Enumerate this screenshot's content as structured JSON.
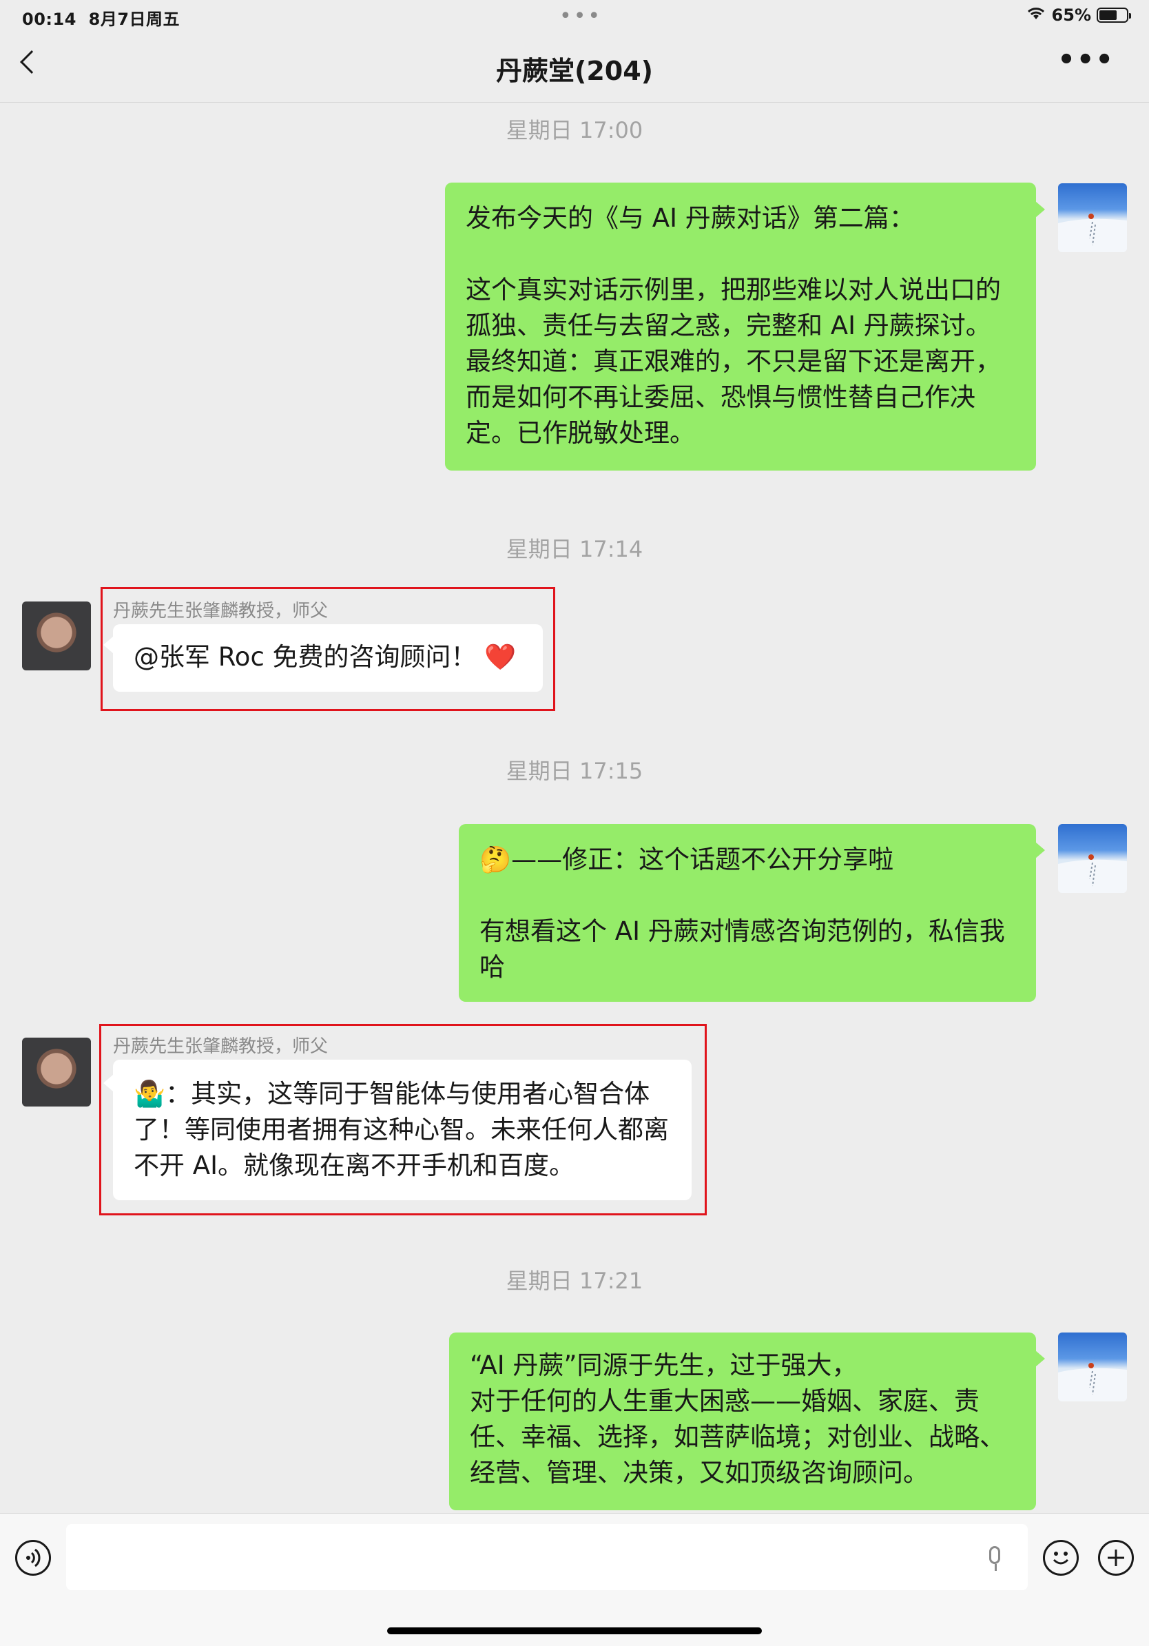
{
  "status_bar": {
    "time": "00:14",
    "date": "8月7日周五",
    "battery": "65%",
    "battery_level": 0.65
  },
  "header": {
    "title": "丹蕨堂(204)"
  },
  "timestamps": [
    "星期日 17:00",
    "星期日 17:14",
    "星期日 17:15",
    "星期日 17:21"
  ],
  "messages": [
    {
      "side": "right",
      "text": "发布今天的《与 AI 丹蕨对话》第二篇：\n\n这个真实对话示例里，把那些难以对人说出口的孤独、责任与去留之惑，完整和 AI 丹蕨探讨。最终知道：真正艰难的，不只是留下还是离开，而是如何不再让委屈、恐惧与惯性替自己作决定。已作脱敏处理。"
    },
    {
      "side": "left",
      "sender": "丹蕨先生张肇麟教授，师父",
      "text": "@张军 Roc 免费的咨询顾问！ ❤️"
    },
    {
      "side": "right",
      "text": "🤔——修正：这个话题不公开分享啦\n\n有想看这个 AI 丹蕨对情感咨询范例的，私信我哈"
    },
    {
      "side": "left",
      "sender": "丹蕨先生张肇麟教授，师父",
      "text": "🤷‍♂️：其实，这等同于智能体与使用者心智合体了！等同使用者拥有这种心智。未来任何人都离不开 AI。就像现在离不开手机和百度。"
    },
    {
      "side": "right",
      "text": "“AI 丹蕨”同源于先生，过于强大，\n对于任何的人生重大困惑——婚姻、家庭、责任、幸福、选择，如菩萨临境；对创业、战略、经营、管理、决策，又如顶级咨询顾问。"
    }
  ],
  "colors": {
    "green_bubble": "#95ec69",
    "white_bubble": "#ffffff",
    "highlight_box": "#e0141c",
    "background": "#ededed"
  },
  "icons": {
    "back": "chevron-left-icon",
    "more": "ellipsis-icon",
    "voice": "voice-icon",
    "mic": "mic-icon",
    "emoji": "emoji-icon",
    "add": "plus-icon"
  }
}
